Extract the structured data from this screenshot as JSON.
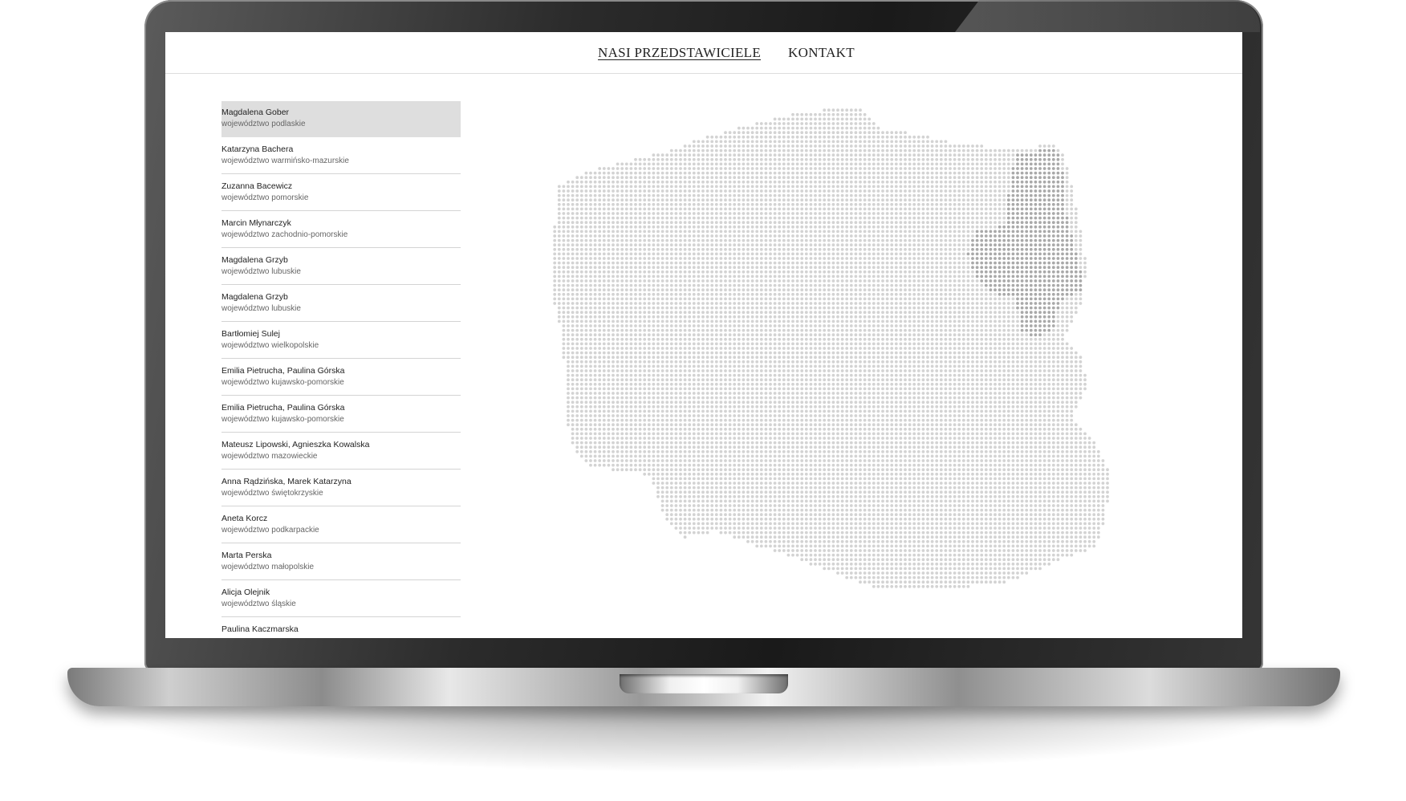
{
  "nav": {
    "links": [
      "NASI PRZEDSTAWICIELE",
      "KONTAKT"
    ]
  },
  "representatives": [
    {
      "name": "Magdalena Gober",
      "region": "województwo podlaskie"
    },
    {
      "name": "Katarzyna Bachera",
      "region": "województwo warmińsko-mazurskie"
    },
    {
      "name": "Zuzanna Bacewicz",
      "region": "województwo pomorskie"
    },
    {
      "name": "Marcin Młynarczyk",
      "region": "województwo zachodnio-pomorskie"
    },
    {
      "name": "Magdalena Grzyb",
      "region": "województwo lubuskie"
    },
    {
      "name": "Magdalena Grzyb",
      "region": "województwo lubuskie"
    },
    {
      "name": "Bartłomiej Sulej",
      "region": "województwo wielkopolskie"
    },
    {
      "name": "Emilia Pietrucha, Paulina Górska",
      "region": "województwo kujawsko-pomorskie"
    },
    {
      "name": "Emilia Pietrucha, Paulina Górska",
      "region": "województwo kujawsko-pomorskie"
    },
    {
      "name": "Mateusz Lipowski, Agnieszka Kowalska",
      "region": "województwo mazowieckie"
    },
    {
      "name": "Anna Rądzińska, Marek Katarzyna",
      "region": "województwo świętokrzyskie"
    },
    {
      "name": "Aneta Korcz",
      "region": "województwo podkarpackie"
    },
    {
      "name": "Marta Perska",
      "region": "województwo małopolskie"
    },
    {
      "name": "Alicja Olejnik",
      "region": "województwo śląskie"
    },
    {
      "name": "Paulina Kaczmarska",
      "region": ""
    }
  ],
  "selected_index": 0,
  "map": {
    "dot_color": "#d3d3d3",
    "highlight_color": "#a9a9a9",
    "highlight_region": "podlaskie"
  }
}
